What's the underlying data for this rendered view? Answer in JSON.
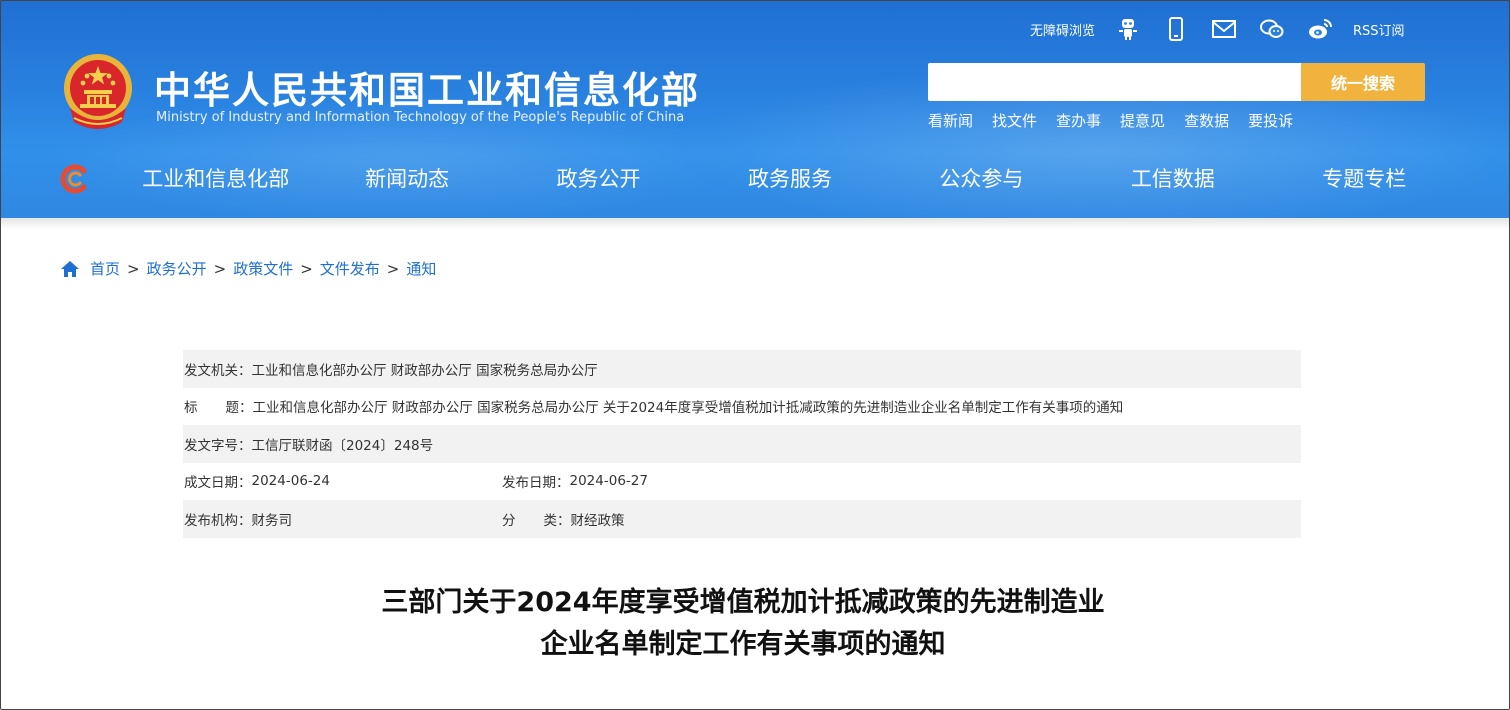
{
  "header": {
    "title_cn": "中华人民共和国工业和信息化部",
    "title_en": "Ministry of Industry and Information Technology of the People's Republic of China",
    "accessibility_label": "无障碍浏览",
    "rss_label": "RSS订阅",
    "icons": [
      "robot-assistant-icon",
      "mobile-icon",
      "mail-icon",
      "wechat-icon",
      "weibo-icon"
    ],
    "search": {
      "placeholder": "",
      "button_label": "统一搜索"
    },
    "quick_links": [
      "看新闻",
      "找文件",
      "查办事",
      "提意见",
      "查数据",
      "要投诉"
    ]
  },
  "nav": {
    "items": [
      "工业和信息化部",
      "新闻动态",
      "政务公开",
      "政务服务",
      "公众参与",
      "工信数据",
      "专题专栏"
    ]
  },
  "breadcrumb": {
    "items": [
      "首页",
      "政务公开",
      "政策文件",
      "文件发布",
      "通知"
    ],
    "separator": ">"
  },
  "meta": {
    "issuer_label": "发文机关：",
    "issuer": "工业和信息化部办公厅 财政部办公厅 国家税务总局办公厅",
    "title_label_a": "标",
    "title_label_b": "题：",
    "title": "工业和信息化部办公厅 财政部办公厅 国家税务总局办公厅 关于2024年度享受增值税加计抵减政策的先进制造业企业名单制定工作有关事项的通知",
    "doc_no_label": "发文字号：",
    "doc_no": "工信厅联财函〔2024〕248号",
    "created_label": "成文日期：",
    "created": "2024-06-24",
    "published_label": "发布日期：",
    "published": "2024-06-27",
    "org_label": "发布机构：",
    "org": "财务司",
    "category_label_a": "分",
    "category_label_b": "类：",
    "category": "财经政策"
  },
  "document": {
    "title_line1": "三部门关于2024年度享受增值税加计抵减政策的先进制造业",
    "title_line2": "企业名单制定工作有关事项的通知"
  },
  "colors": {
    "header_blue": "#2a82e0",
    "search_button": "#f2b23e",
    "link_blue": "#1f6fd2",
    "row_shade": "#f2f2f2"
  }
}
